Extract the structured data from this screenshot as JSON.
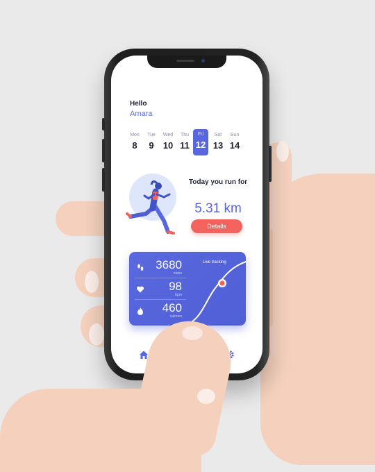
{
  "greeting": {
    "hello": "Hello",
    "name": "Amara"
  },
  "calendar": {
    "days": [
      {
        "label": "Mon",
        "date": "8"
      },
      {
        "label": "Tue",
        "date": "9"
      },
      {
        "label": "Wed",
        "date": "10"
      },
      {
        "label": "Thu",
        "date": "11"
      },
      {
        "label": "Fri",
        "date": "12",
        "selected": true
      },
      {
        "label": "Sat",
        "date": "13"
      },
      {
        "label": "Sun",
        "date": "14"
      }
    ]
  },
  "run": {
    "heading": "Today you run for",
    "distance": "5.31 km",
    "details_label": "Details"
  },
  "stats": {
    "steps": {
      "value": "3680",
      "unit": "steps",
      "icon": "footprints-icon"
    },
    "heart": {
      "value": "98",
      "unit": "bpm",
      "icon": "heart-icon"
    },
    "calories": {
      "value": "460",
      "unit": "calories",
      "icon": "flame-icon"
    },
    "live_label": "Live tracking"
  },
  "nav": {
    "items": [
      "home-icon",
      "activity-icon",
      "bell-icon",
      "gear-icon"
    ]
  },
  "colors": {
    "accent": "#5866e0",
    "button": "#f2635e",
    "card": "#5b68de",
    "background": "#eaeaea"
  }
}
